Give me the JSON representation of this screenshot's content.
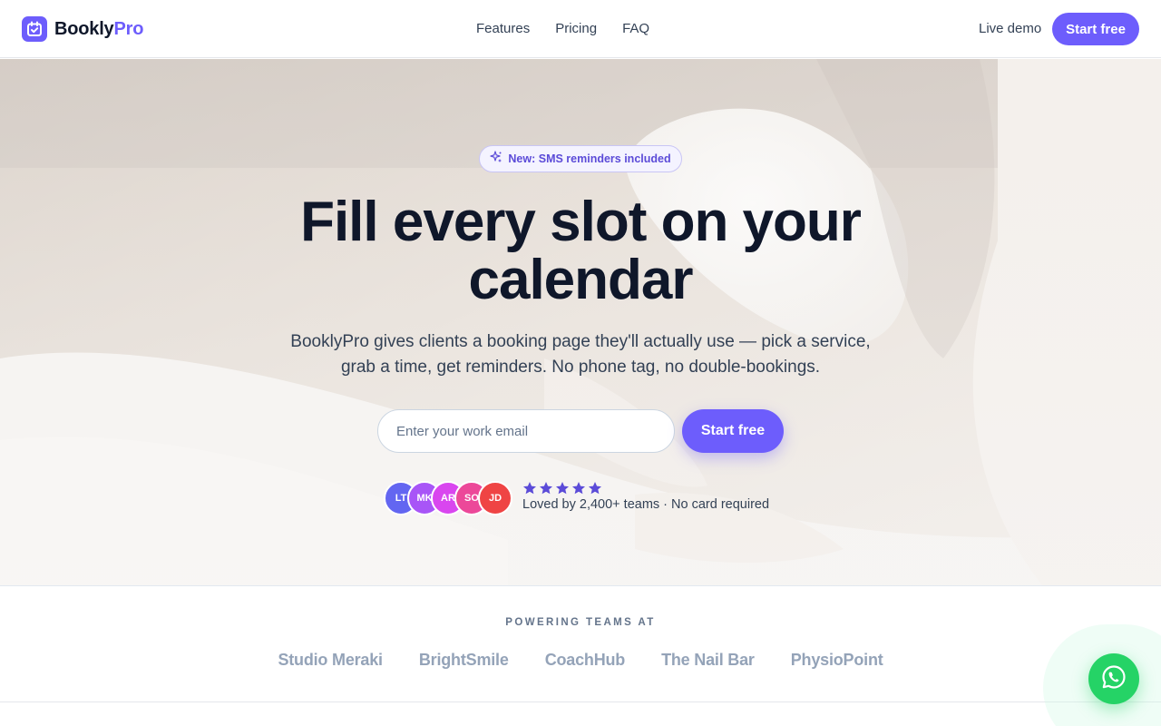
{
  "header": {
    "brand": {
      "name_main": "Bookly",
      "name_accent": "Pro",
      "accent_color": "#6d5dfc"
    },
    "nav": [
      {
        "label": "Features"
      },
      {
        "label": "Pricing"
      },
      {
        "label": "FAQ"
      }
    ],
    "live_demo_label": "Live demo",
    "cta_label": "Start free"
  },
  "hero": {
    "badge_icon": "sparkle-icon",
    "badge_text": "New: SMS reminders included",
    "headline_line1": "Fill every slot on your",
    "headline_line2": "calendar",
    "subtext_line1": "BooklyPro gives clients a booking page they'll actually use — pick a service,",
    "subtext_line2": "grab a time, get reminders. No phone tag, no double-bookings.",
    "email_placeholder": "Enter your work email",
    "cta_label": "Start free",
    "avatars": [
      {
        "initials": "LT",
        "color": "#6366f1"
      },
      {
        "initials": "MK",
        "color": "#a855f7"
      },
      {
        "initials": "AR",
        "color": "#d946ef"
      },
      {
        "initials": "SO",
        "color": "#ec4899"
      },
      {
        "initials": "JD",
        "color": "#ef4444"
      }
    ],
    "rating_stars": 5,
    "social_proof": "Loved by 2,400+ teams · No card required"
  },
  "logos": {
    "label": "POWERING TEAMS AT",
    "items": [
      "Studio Meraki",
      "BrightSmile",
      "CoachHub",
      "The Nail Bar",
      "PhysioPoint"
    ]
  },
  "floating": {
    "whatsapp_icon": "whatsapp-icon",
    "color": "#25d366"
  }
}
